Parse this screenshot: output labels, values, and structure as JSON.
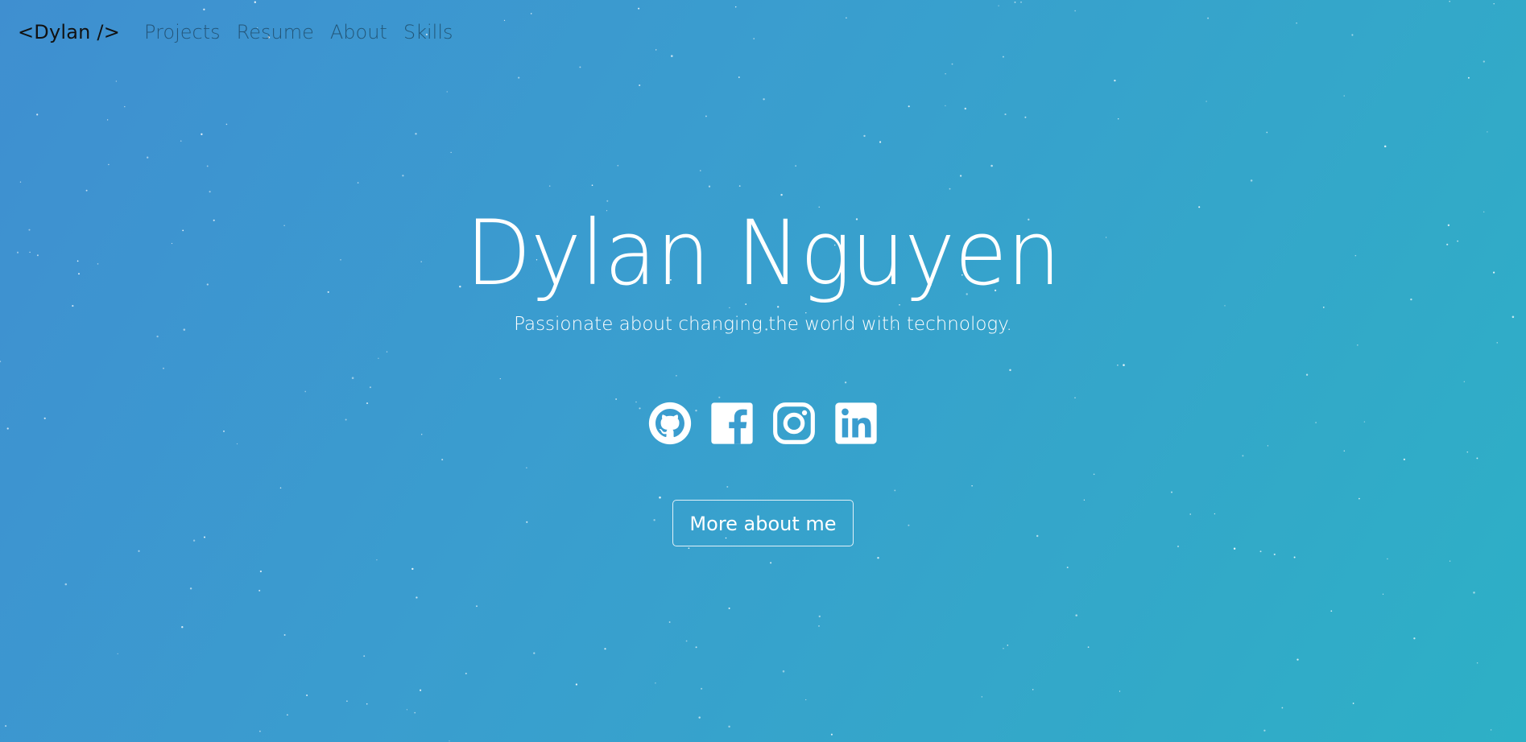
{
  "nav": {
    "brand": "<Dylan />",
    "links": [
      "Projects",
      "Resume",
      "About",
      "Skills"
    ]
  },
  "hero": {
    "title": "Dylan Nguyen",
    "subtitle": "Passionate about changing the world with technology.",
    "socials": [
      {
        "icon": "github-icon"
      },
      {
        "icon": "facebook-icon"
      },
      {
        "icon": "instagram-icon"
      },
      {
        "icon": "linkedin-icon"
      }
    ],
    "cta_label": "More about me"
  },
  "colors": {
    "background_start": "#3f8fd0",
    "background_end": "#2db0c6",
    "text": "#ffffff",
    "brand_text": "#111111"
  }
}
